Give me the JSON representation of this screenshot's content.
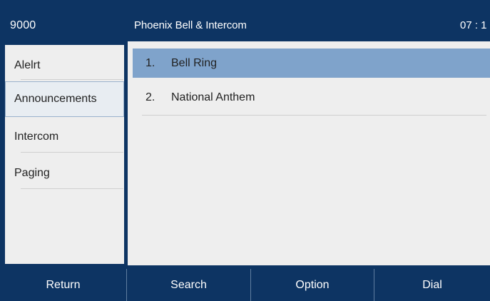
{
  "status_bar": {
    "extension": "9000",
    "title": "Phoenix Bell & Intercom",
    "time": "07 : 1"
  },
  "sidebar": {
    "items": [
      {
        "label": "Alelrt",
        "selected": false
      },
      {
        "label": "Announcements",
        "selected": true
      },
      {
        "label": "Intercom",
        "selected": false
      },
      {
        "label": "Paging",
        "selected": false
      }
    ]
  },
  "main": {
    "items": [
      {
        "number": "1.",
        "label": "Bell Ring",
        "highlighted": true
      },
      {
        "number": "2.",
        "label": "National Anthem",
        "highlighted": false
      }
    ]
  },
  "softkeys": {
    "return": "Return",
    "search": "Search",
    "option": "Option",
    "dial": "Dial"
  },
  "colors": {
    "header_bg": "#0d3463",
    "panel_bg": "#eeeeee",
    "highlight": "#7fa3cb",
    "text": "#222222"
  }
}
